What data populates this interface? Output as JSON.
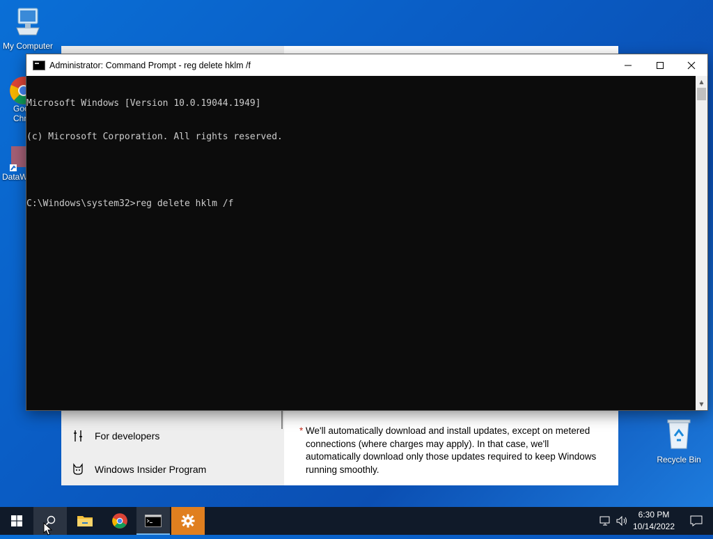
{
  "desktop": {
    "icons": [
      {
        "label": "My Computer"
      },
      {
        "label": "Goo\nChro"
      },
      {
        "label": "DataW"
      },
      {
        "label": "Recycle Bin"
      }
    ]
  },
  "settings_window": {
    "nav_items": [
      {
        "label": "For developers",
        "icon": "developer-tools-icon"
      },
      {
        "label": "Windows Insider Program",
        "icon": "insider-cat-icon"
      }
    ],
    "note_asterisk": "*",
    "note_text": "We'll automatically download and install updates, except on metered connections (where charges may apply). In that case, we'll automatically download only those updates required to keep Windows running smoothly."
  },
  "cmd_window": {
    "title": "Administrator: Command Prompt - reg  delete hklm /f",
    "lines": [
      "Microsoft Windows [Version 10.0.19044.1949]",
      "(c) Microsoft Corporation. All rights reserved.",
      "",
      "C:\\Windows\\system32>reg delete hklm /f"
    ]
  },
  "taskbar": {
    "buttons": [
      "start-icon",
      "search-icon",
      "file-explorer-icon",
      "chrome-icon",
      "command-prompt-icon",
      "settings-gear-icon"
    ],
    "clock_time": "6:30 PM",
    "clock_date": "10/14/2022"
  },
  "colors": {
    "desktop_blue": "#0a5cc4",
    "taskbar": "#101a29",
    "console_bg": "#0c0c0c",
    "console_text": "#cccccc",
    "settings_taskbar_accent": "#e07f1f"
  }
}
